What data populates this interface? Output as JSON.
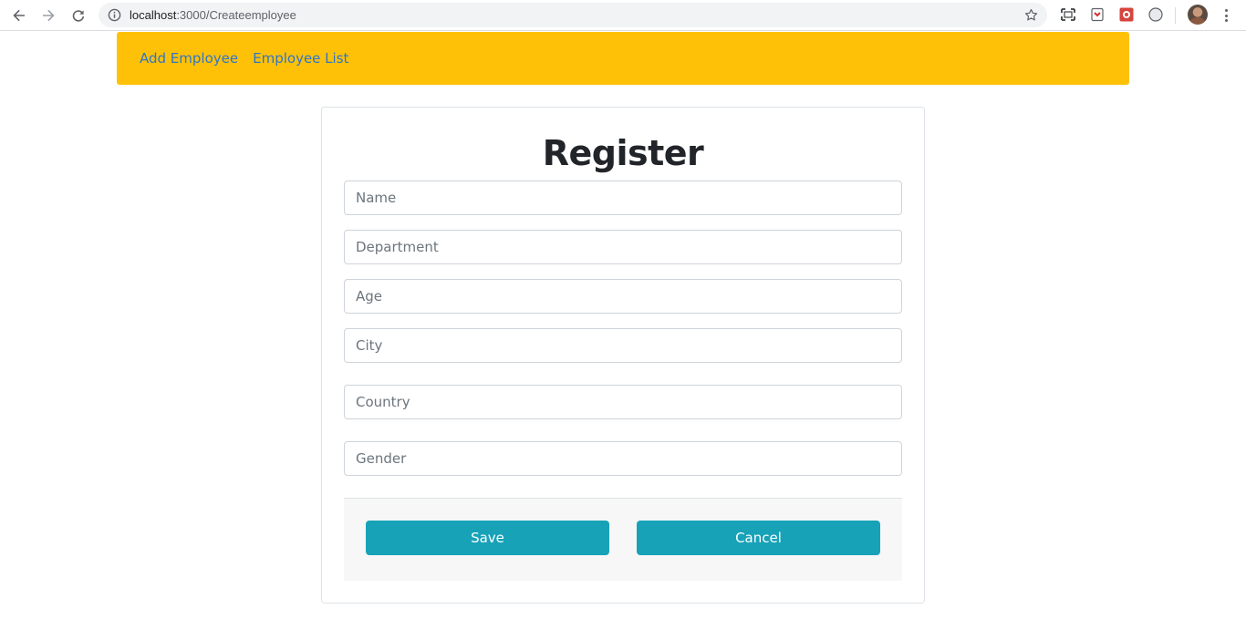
{
  "browser": {
    "url_host": "localhost",
    "url_path": ":3000/Createemployee",
    "icons": [
      "back-arrow-icon",
      "forward-arrow-icon",
      "reload-icon",
      "site-info-icon",
      "bookmark-star-icon",
      "screencast-icon",
      "pocket-icon",
      "extension-icon",
      "dark-mode-icon",
      "profile-avatar",
      "menu-icon"
    ]
  },
  "navbar": {
    "background": "#ffc107",
    "links": [
      {
        "label": "Add Employee"
      },
      {
        "label": "Employee List"
      }
    ]
  },
  "form": {
    "title": "Register",
    "fields": [
      {
        "placeholder": "Name",
        "value": ""
      },
      {
        "placeholder": "Department",
        "value": ""
      },
      {
        "placeholder": "Age",
        "value": ""
      },
      {
        "placeholder": "City",
        "value": ""
      },
      {
        "placeholder": "Country",
        "value": ""
      },
      {
        "placeholder": "Gender",
        "value": ""
      }
    ],
    "save_label": "Save",
    "cancel_label": "Cancel",
    "button_color": "#17a2b8"
  }
}
